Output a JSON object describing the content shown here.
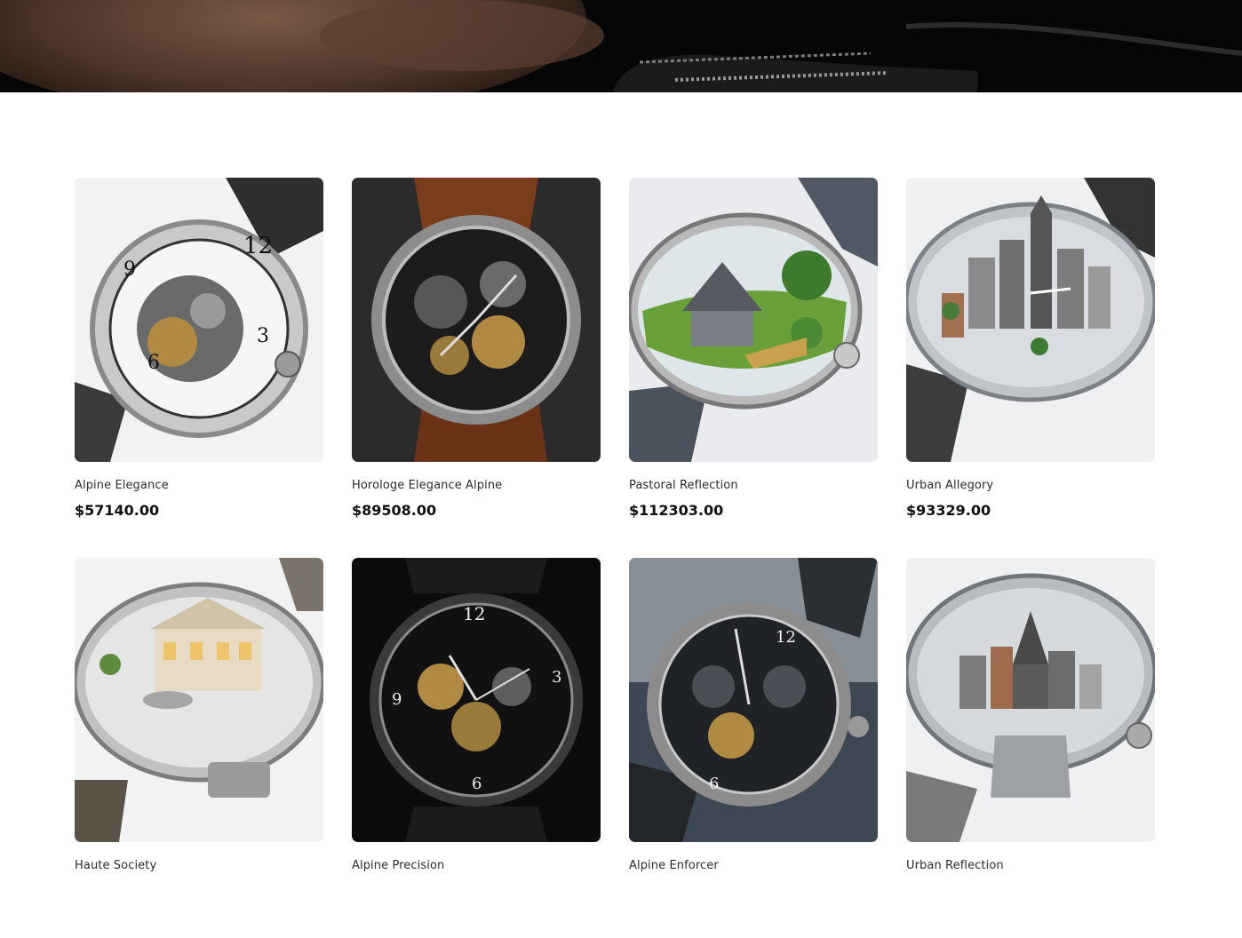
{
  "hero": {
    "image": "hero-wristwatch-closeup"
  },
  "products": [
    {
      "name": "Alpine Elegance",
      "price": "$57140.00",
      "image": "skeleton-watch-white-dial",
      "theme": "light"
    },
    {
      "name": "Horologe Elegance Alpine",
      "price": "$89508.00",
      "image": "skeleton-watch-brown-strap",
      "theme": "dark"
    },
    {
      "name": "Pastoral Reflection",
      "price": "$112303.00",
      "image": "watch-with-farm-scene",
      "theme": "farm"
    },
    {
      "name": "Urban Allegory",
      "price": "$93329.00",
      "image": "watch-with-city-scene",
      "theme": "city"
    },
    {
      "name": "Haute Society",
      "price": "",
      "image": "watch-with-mansion-scene",
      "theme": "mansion"
    },
    {
      "name": "Alpine Precision",
      "price": "",
      "image": "skeleton-watch-black-dial",
      "theme": "black"
    },
    {
      "name": "Alpine Enforcer",
      "price": "",
      "image": "chronograph-skeleton-watch",
      "theme": "chrono"
    },
    {
      "name": "Urban Reflection",
      "price": "",
      "image": "watch-with-metropolis-scene",
      "theme": "metro"
    }
  ]
}
